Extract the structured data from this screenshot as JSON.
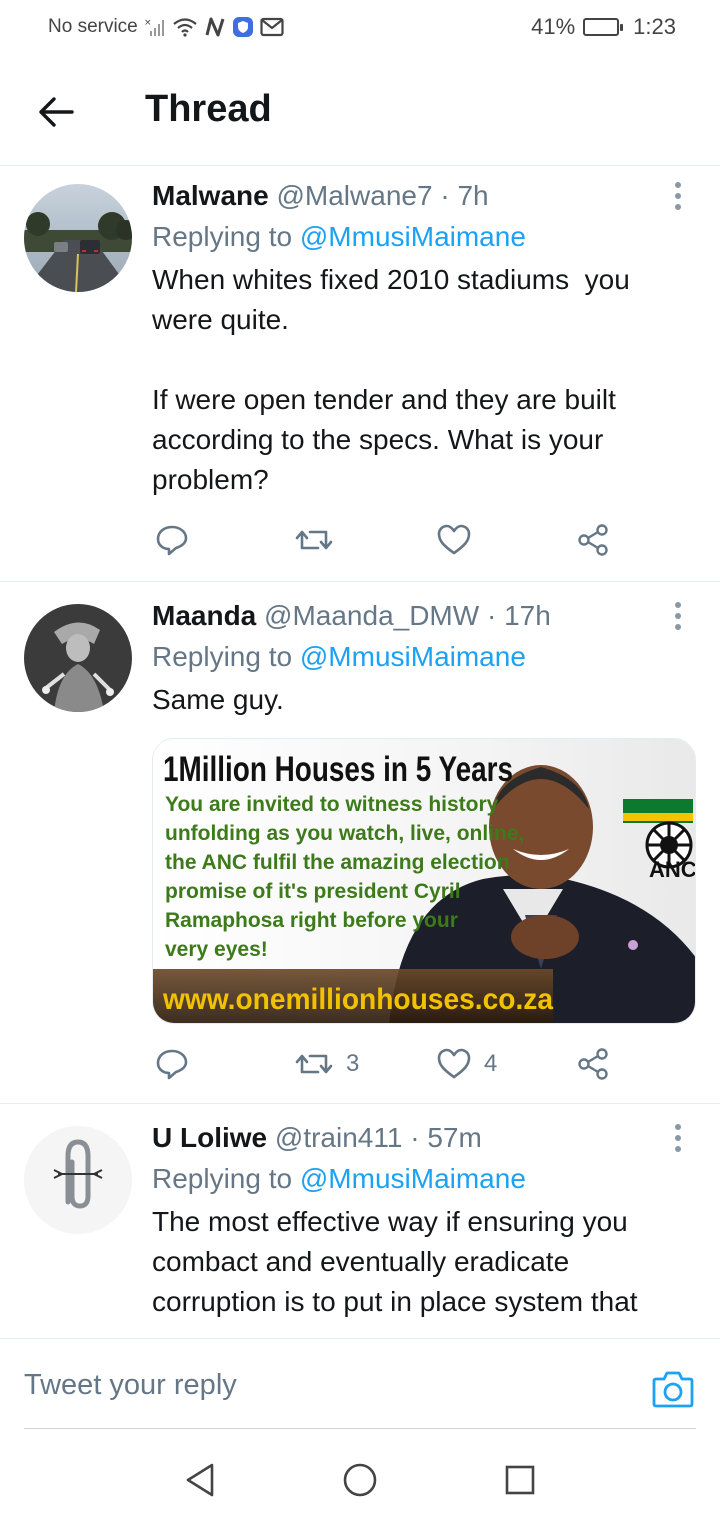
{
  "status_bar": {
    "carrier": "No service",
    "battery_percent": "41%",
    "battery_level": 0.41,
    "time": "1:23"
  },
  "header": {
    "title": "Thread"
  },
  "tweets": [
    {
      "name": "Malwane",
      "handle": "@Malwane7",
      "separator": "·",
      "time": "7h",
      "replying_prefix": "Replying to",
      "replying_to": "@MmusiMaimane",
      "text": "When whites fixed 2010 stadiums  you were quite.\n\nIf were open tender and they are built according to the specs. What is your problem?",
      "retweets": "",
      "likes": ""
    },
    {
      "name": "Maanda",
      "handle": "@Maanda_DMW",
      "separator": "·",
      "time": "17h",
      "replying_prefix": "Replying to",
      "replying_to": "@MmusiMaimane",
      "text": "Same guy.",
      "retweets": "3",
      "likes": "4",
      "image": {
        "headline": "1Million Houses in 5 Years",
        "body_lines": [
          "You are invited to witness history",
          "unfolding as you watch, live, online,",
          "the ANC fulfil the amazing election",
          "promise of it's president Cyril",
          "Ramaphosa right before your",
          "very eyes!"
        ],
        "url": "www.onemillionhouses.co.za",
        "logo_text": "ANC",
        "colors": {
          "headline": "#111111",
          "body": "#3d7a1a",
          "url": "#f2c200"
        }
      }
    },
    {
      "name": "U Loliwe",
      "handle": "@train411",
      "separator": "·",
      "time": "57m",
      "replying_prefix": "Replying to",
      "replying_to": "@MmusiMaimane",
      "text": "The most effective way if ensuring you combact and eventually eradicate corruption is to put in place system that",
      "retweets": "",
      "likes": ""
    }
  ],
  "reply_bar": {
    "placeholder": "Tweet your reply"
  },
  "icons": {
    "back": "arrow-left-icon",
    "reply": "speech-bubble-icon",
    "retweet": "retweet-icon",
    "like": "heart-icon",
    "share": "share-icon",
    "camera": "camera-icon"
  },
  "colors": {
    "accent": "#1da1f2",
    "secondary_text": "#657786",
    "primary_text": "#14171a"
  }
}
